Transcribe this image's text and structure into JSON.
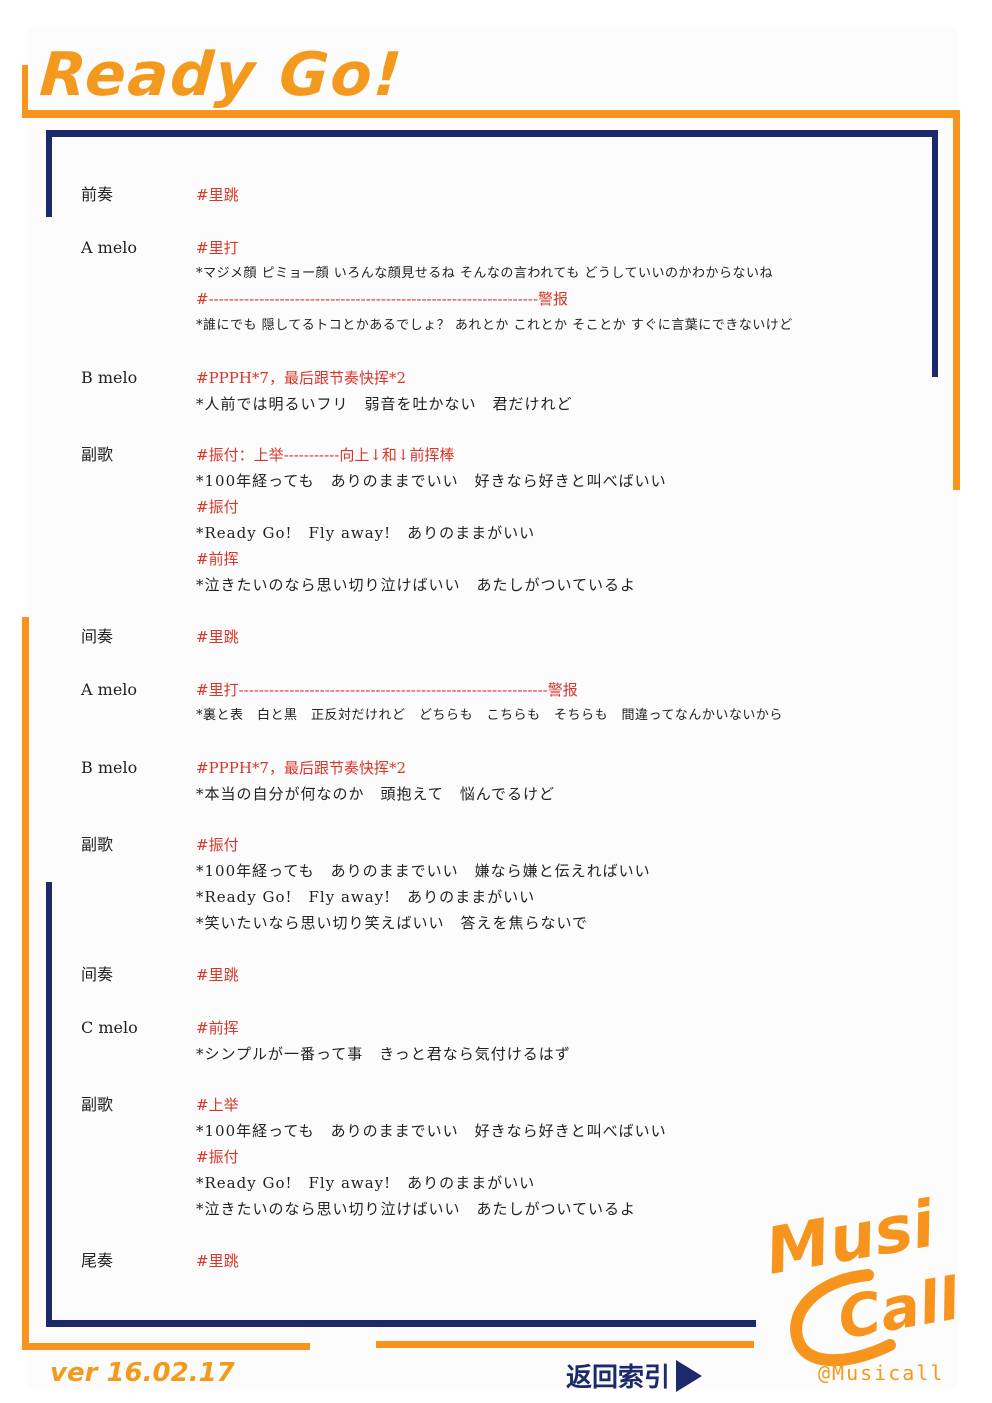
{
  "title": "Ready Go!",
  "version": "ver 16.02.17",
  "index_link": "返回索引",
  "brand": {
    "line1": "Musi",
    "line2": "Call",
    "handle": "@Musicall"
  },
  "colors": {
    "accent": "#f7941d",
    "frame": "#1c2a6b",
    "cue": "#d9362b",
    "text": "#222222"
  },
  "lines": [
    {
      "type": "sec",
      "text": "前奏"
    },
    {
      "type": "cue",
      "text": "#里跳"
    },
    {
      "type": "sec",
      "text": "A melo"
    },
    {
      "type": "cue",
      "text": "#里打"
    },
    {
      "type": "lyr",
      "text": "*マジメ顔 ピミョー顔 いろんな顔見せるね そんなの言われても どうしていいのかわからないね"
    },
    {
      "type": "cue",
      "text": "#-----------------------------------------------------------------警报"
    },
    {
      "type": "lyr",
      "text": "*誰にでも 隠してるトコとかあるでしょ？ あれとか これとか そことか すぐに言葉にできないけど"
    },
    {
      "type": "sec",
      "text": "B melo"
    },
    {
      "type": "cue",
      "text": "#PPPH*7，最后跟节奏快挥*2"
    },
    {
      "type": "lyr",
      "text": "*人前では明るいフリ　弱音を吐かない　君だけれど"
    },
    {
      "type": "sec",
      "text": "副歌"
    },
    {
      "type": "cue",
      "text": "#振付：上举-----------向上↓和↓前挥棒"
    },
    {
      "type": "lyr",
      "text": "*100年経っても　ありのままでいい　好きなら好きと叫べばいい"
    },
    {
      "type": "cue",
      "text": "#振付"
    },
    {
      "type": "lyr",
      "text": "*Ready Go!　Fly away!　ありのままがいい"
    },
    {
      "type": "cue",
      "text": "#前挥"
    },
    {
      "type": "lyr",
      "text": "*泣きたいのなら思い切り泣けばいい　あたしがついているよ"
    },
    {
      "type": "sec",
      "text": "间奏"
    },
    {
      "type": "cue",
      "text": "#里跳"
    },
    {
      "type": "sec",
      "text": "A melo"
    },
    {
      "type": "cue",
      "text": "#里打-------------------------------------------------------------警报"
    },
    {
      "type": "lyr",
      "text": "*裏と表　白と黒　正反対だけれど　どちらも　こちらも　そちらも　間違ってなんかいないから"
    },
    {
      "type": "sec",
      "text": "B melo"
    },
    {
      "type": "cue",
      "text": "#PPPH*7，最后跟节奏快挥*2"
    },
    {
      "type": "lyr",
      "text": "*本当の自分が何なのか　頭抱えて　悩んでるけど"
    },
    {
      "type": "sec",
      "text": "副歌"
    },
    {
      "type": "cue",
      "text": "#振付"
    },
    {
      "type": "lyr",
      "text": "*100年経っても　ありのままでいい　嫌なら嫌と伝えればいい"
    },
    {
      "type": "lyr",
      "text": "*Ready Go!　Fly away!　ありのままがいい"
    },
    {
      "type": "lyr",
      "text": "*笑いたいなら思い切り笑えばいい　答えを焦らないで"
    },
    {
      "type": "sec",
      "text": "间奏"
    },
    {
      "type": "cue",
      "text": "#里跳"
    },
    {
      "type": "sec",
      "text": "C melo"
    },
    {
      "type": "cue",
      "text": "#前挥"
    },
    {
      "type": "lyr",
      "text": "*シンプルが一番って事　きっと君なら気付けるはず"
    },
    {
      "type": "sec",
      "text": "副歌"
    },
    {
      "type": "cue",
      "text": "#上举"
    },
    {
      "type": "lyr",
      "text": "*100年経っても　ありのままでいい　好きなら好きと叫べばいい"
    },
    {
      "type": "cue",
      "text": "#振付"
    },
    {
      "type": "lyr",
      "text": "*Ready Go!　Fly away!　ありのままがいい"
    },
    {
      "type": "lyr",
      "text": "*泣きたいのなら思い切り泣けばいい　あたしがついているよ"
    },
    {
      "type": "sec",
      "text": "尾奏"
    },
    {
      "type": "cue",
      "text": "#里跳"
    }
  ]
}
